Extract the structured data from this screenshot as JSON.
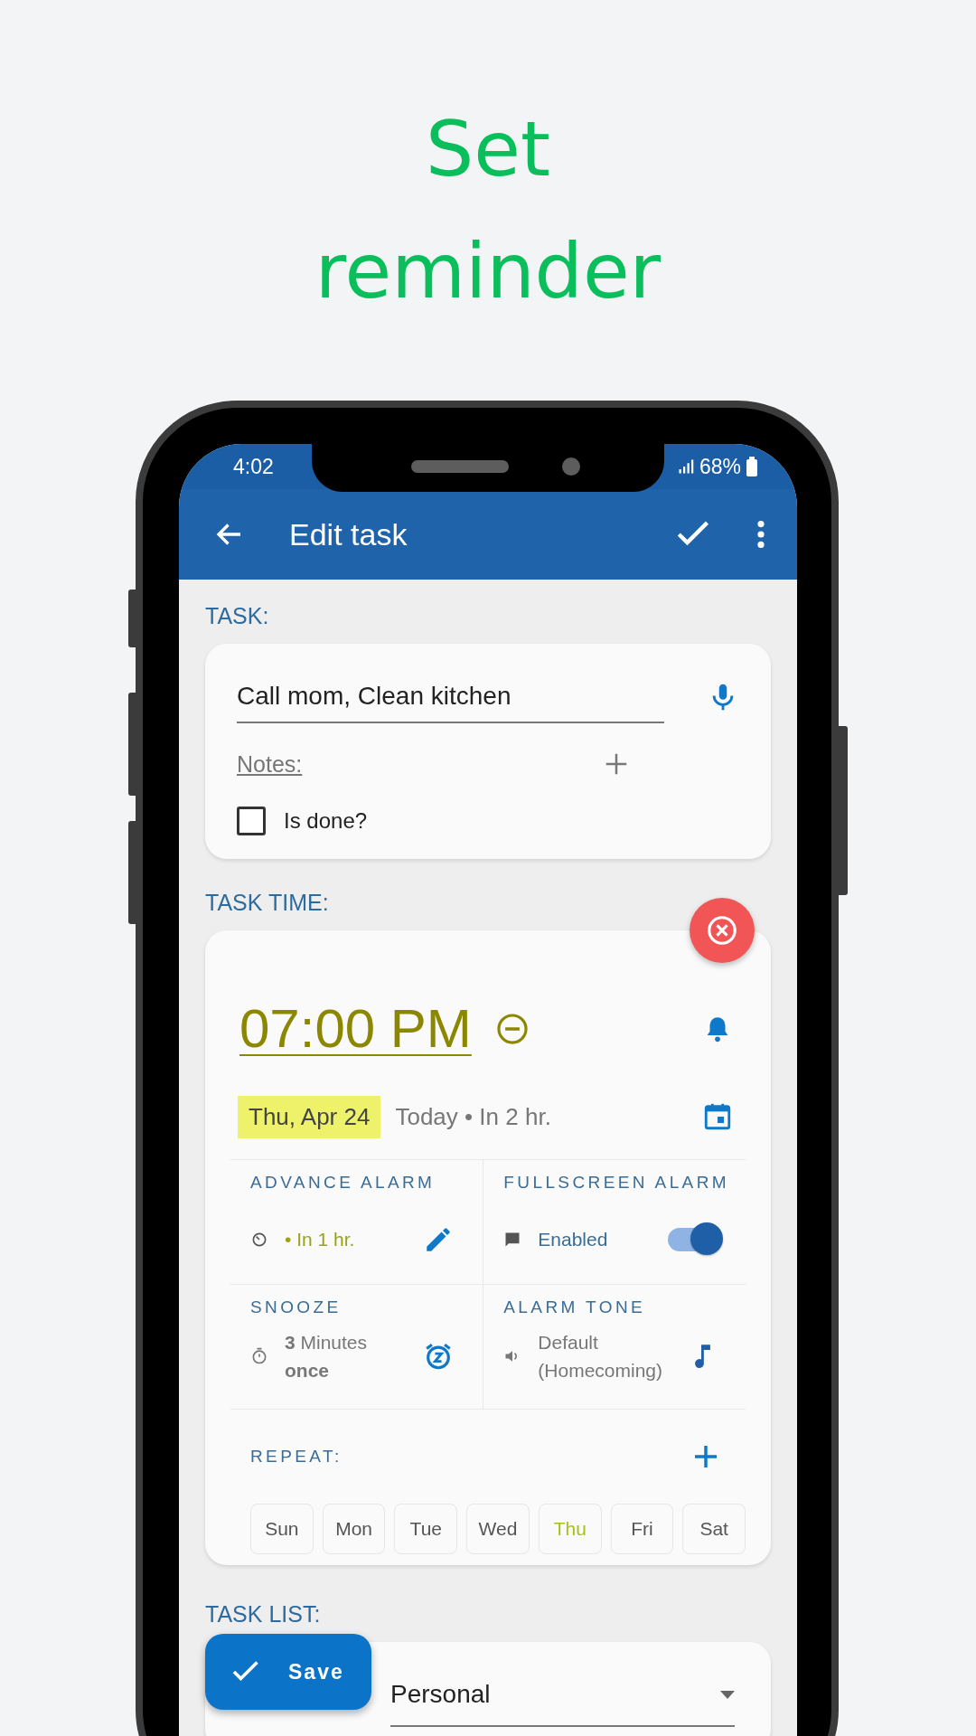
{
  "headline": "Set reminder",
  "status_bar": {
    "time": "4:02",
    "battery": "68%"
  },
  "app_bar": {
    "title": "Edit task"
  },
  "task": {
    "section_label": "TASK:",
    "title_value": "Call mom, Clean kitchen",
    "notes_label": "Notes:",
    "done_label": "Is done?",
    "done_checked": false
  },
  "task_time": {
    "section_label": "TASK TIME:",
    "time": "07:00 PM",
    "date": "Thu, Apr 24",
    "relative": "Today • In 2 hr.",
    "advance_alarm": {
      "label": "ADVANCE ALARM",
      "value": "• In 1 hr."
    },
    "fullscreen_alarm": {
      "label": "FULLSCREEN ALARM",
      "value": "Enabled",
      "on": true
    },
    "snooze": {
      "label": "SNOOZE",
      "value": "**3** Minutes",
      "repeat": "once"
    },
    "alarm_tone": {
      "label": "ALARM TONE",
      "value": "Default (Homecoming)"
    },
    "repeat": {
      "label": "REPEAT:",
      "days": [
        {
          "label": "Sun",
          "selected": false
        },
        {
          "label": "Mon",
          "selected": false
        },
        {
          "label": "Tue",
          "selected": false
        },
        {
          "label": "Wed",
          "selected": false
        },
        {
          "label": "Thu",
          "selected": true
        },
        {
          "label": "Fri",
          "selected": false
        },
        {
          "label": "Sat",
          "selected": false
        }
      ]
    }
  },
  "task_list": {
    "section_label": "TASK LIST:",
    "value": "Personal"
  },
  "fab": {
    "label": "Save"
  }
}
